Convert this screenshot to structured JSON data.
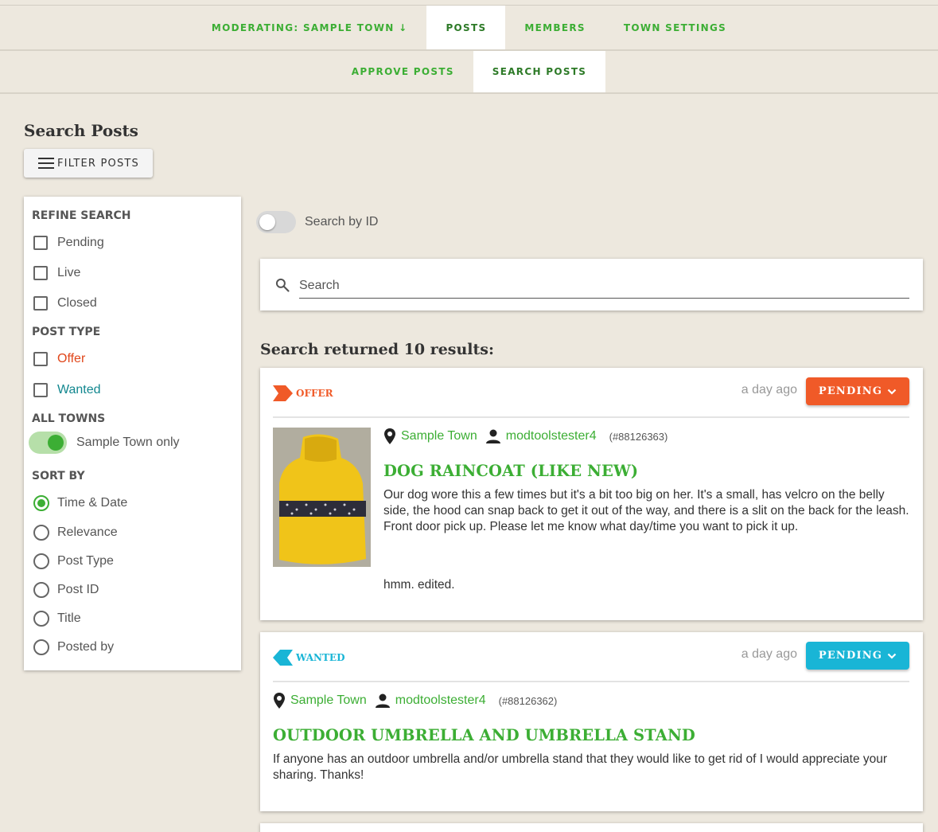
{
  "nav": {
    "moderating": "MODERATING: SAMPLE TOWN ↓",
    "posts": "POSTS",
    "members": "MEMBERS",
    "town_settings": "TOWN SETTINGS",
    "approve_posts": "APPROVE POSTS",
    "search_posts": "SEARCH POSTS"
  },
  "page_title": "Search Posts",
  "filter_button": "FILTER POSTS",
  "sidebar": {
    "refine_title": "REFINE SEARCH",
    "status_options": [
      "Pending",
      "Live",
      "Closed"
    ],
    "post_type_title": "POST TYPE",
    "type_options": [
      "Offer",
      "Wanted"
    ],
    "all_towns_title": "ALL TOWNS",
    "town_toggle_label": "Sample Town only",
    "sort_title": "SORT BY",
    "sort_options": [
      "Time & Date",
      "Relevance",
      "Post Type",
      "Post ID",
      "Title",
      "Posted by"
    ],
    "sort_selected": "Time & Date"
  },
  "search_by_id_label": "Search by ID",
  "search": {
    "placeholder": "Search",
    "value": ""
  },
  "results_title": "Search returned 10 results:",
  "colors": {
    "green": "#3cae34",
    "offer": "#f05a28",
    "wanted": "#19b5d6",
    "offer_text": "#e0461a",
    "wanted_text": "#12878f"
  },
  "posts": [
    {
      "type": "OFFER",
      "time": "a day ago",
      "status": "PENDING",
      "town": "Sample Town",
      "user": "modtoolstester4",
      "post_id": "(#88126363)",
      "title": "DOG RAINCOAT (LIKE NEW)",
      "body": "Our dog wore this a few times but it's a bit too big on her. It's a small, has velcro on the belly side, the hood can snap back to get it out of the way, and there is a slit on the back for the leash. Front door pick up. Please let me know what day/time you want to pick it up.",
      "note": "hmm. edited."
    },
    {
      "type": "WANTED",
      "time": "a day ago",
      "status": "PENDING",
      "town": "Sample Town",
      "user": "modtoolstester4",
      "post_id": "(#88126362)",
      "title": "OUTDOOR UMBRELLA AND UMBRELLA STAND",
      "body": "If anyone has an outdoor umbrella and/or umbrella stand that they would like to get rid of I would appreciate your sharing. Thanks!"
    }
  ]
}
